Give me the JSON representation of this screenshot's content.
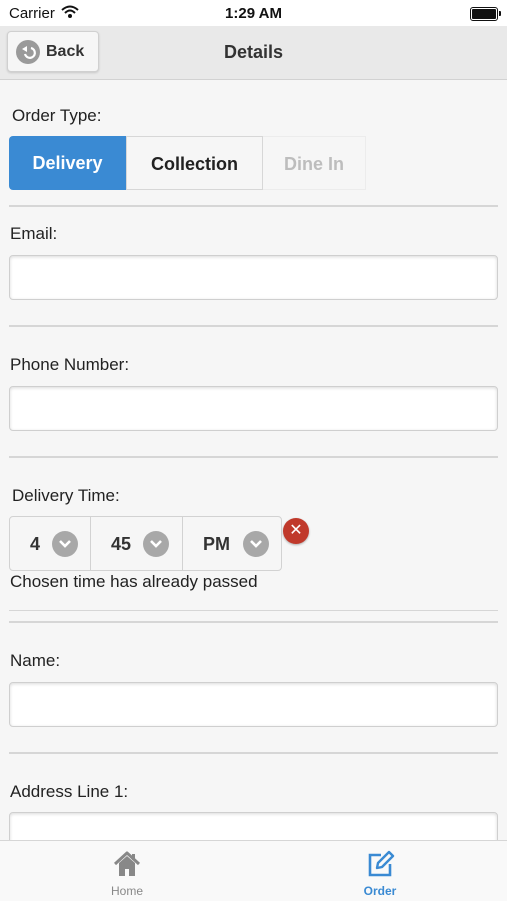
{
  "status_bar": {
    "carrier": "Carrier",
    "time": "1:29 AM"
  },
  "header": {
    "back_label": "Back",
    "title": "Details"
  },
  "order_type": {
    "label": "Order Type:",
    "options": [
      "Delivery",
      "Collection",
      "Dine In"
    ],
    "selected": "Delivery"
  },
  "email": {
    "label": "Email:",
    "value": ""
  },
  "phone": {
    "label": "Phone Number:",
    "value": ""
  },
  "delivery_time": {
    "label": "Delivery Time:",
    "hour": "4",
    "minute": "45",
    "ampm": "PM",
    "error": "Chosen time has already passed"
  },
  "name": {
    "label": "Name:",
    "value": ""
  },
  "address1": {
    "label": "Address Line 1:",
    "value": ""
  },
  "tabs": [
    {
      "label": "Home",
      "icon": "home-icon"
    },
    {
      "label": "Order",
      "icon": "edit-icon"
    }
  ],
  "colors": {
    "accent": "#3a8ad3",
    "error": "#c0392b"
  }
}
